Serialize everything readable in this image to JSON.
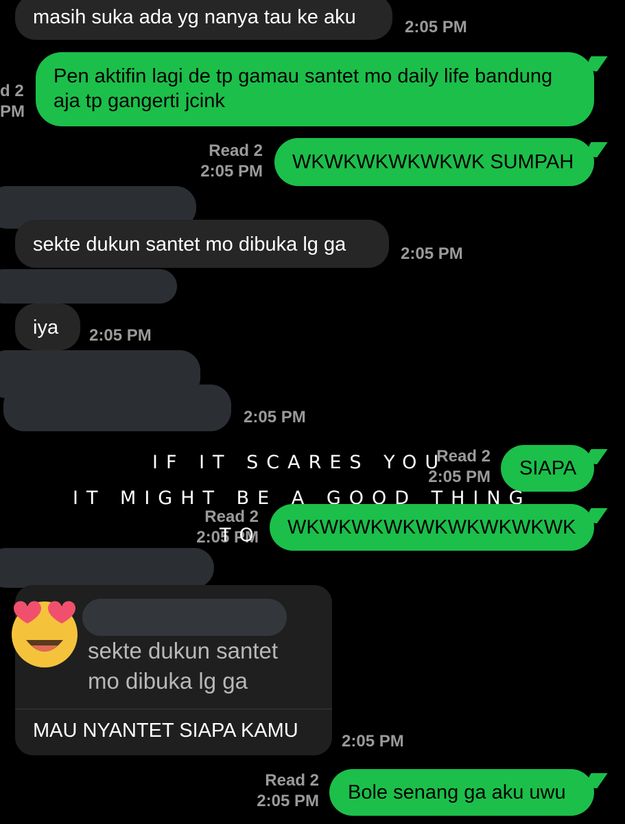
{
  "messages": [
    {
      "id": "m1",
      "text": "masih suka ada yg nanya tau ke aku",
      "time": "2:05 PM"
    },
    {
      "id": "m2",
      "text": "Pen aktifin lagi de tp gamau santet mo daily life bandung aja tp gangerti jcink",
      "read": "d 2",
      "time": "PM"
    },
    {
      "id": "m3",
      "text": "WKWKWKWKWKWK SUMPAH",
      "read": "Read 2",
      "time": "2:05 PM"
    },
    {
      "id": "m4",
      "text": "sekte dukun santet mo dibuka lg ga",
      "time": "2:05 PM"
    },
    {
      "id": "m5",
      "text": "iya",
      "time": "2:05 PM"
    },
    {
      "id": "m6",
      "time": "2:05 PM"
    },
    {
      "id": "m7",
      "text": "SIAPA",
      "read": "Read 2",
      "time": "2:05 PM"
    },
    {
      "id": "m8",
      "text": "WKWKWKWKWKWKWKWKWK",
      "read": "Read 2",
      "time": "2:05 PM"
    },
    {
      "id": "m9",
      "quoted": "sekte dukun santet mo dibuka lg ga",
      "text": "MAU NYANTET SIAPA KAMU",
      "time": "2:05 PM"
    },
    {
      "id": "m10",
      "text": "Bole senang ga aku uwu",
      "read": "Read 2",
      "time": "2:05 PM"
    }
  ],
  "overlay": {
    "line1": "IF IT SCARES YOU",
    "line2": "IT MIGHT BE A GOOD THING",
    "line3": "TO"
  },
  "reaction": {
    "icon": "heart-eyes-emoji-icon"
  },
  "colors": {
    "background": "#000000",
    "outgoing": "#1cbf4a",
    "incoming": "#262626",
    "meta": "#9a9a9a"
  }
}
